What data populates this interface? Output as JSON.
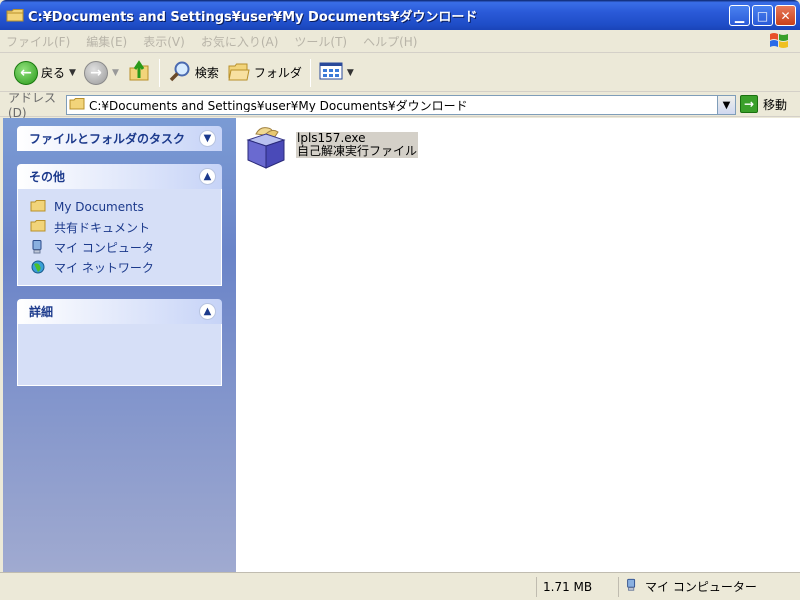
{
  "window": {
    "title": "C:¥Documents and Settings¥user¥My Documents¥ダウンロード"
  },
  "menu": {
    "items": [
      "ファイル(F)",
      "編集(E)",
      "表示(V)",
      "お気に入り(A)",
      "ツール(T)",
      "ヘルプ(H)"
    ]
  },
  "toolbar": {
    "back_label": "戻る",
    "search_label": "検索",
    "folders_label": "フォルダ"
  },
  "address": {
    "label": "アドレス(D)",
    "value": "C:¥Documents and Settings¥user¥My Documents¥ダウンロード",
    "go_label": "移動"
  },
  "sidebar": {
    "tasks_title": "ファイルとフォルダのタスク",
    "other_title": "その他",
    "other_items": [
      {
        "label": "My Documents",
        "icon": "folder-icon"
      },
      {
        "label": "共有ドキュメント",
        "icon": "folder-icon"
      },
      {
        "label": "マイ コンピュータ",
        "icon": "computer-icon"
      },
      {
        "label": "マイ ネットワーク",
        "icon": "network-icon"
      }
    ],
    "details_title": "詳細"
  },
  "files": [
    {
      "name": "lpls157.exe",
      "type": "自己解凍実行ファイル",
      "icon": "installer-box-icon"
    }
  ],
  "status": {
    "size": "1.71 MB",
    "location": "マイ コンピューター"
  }
}
